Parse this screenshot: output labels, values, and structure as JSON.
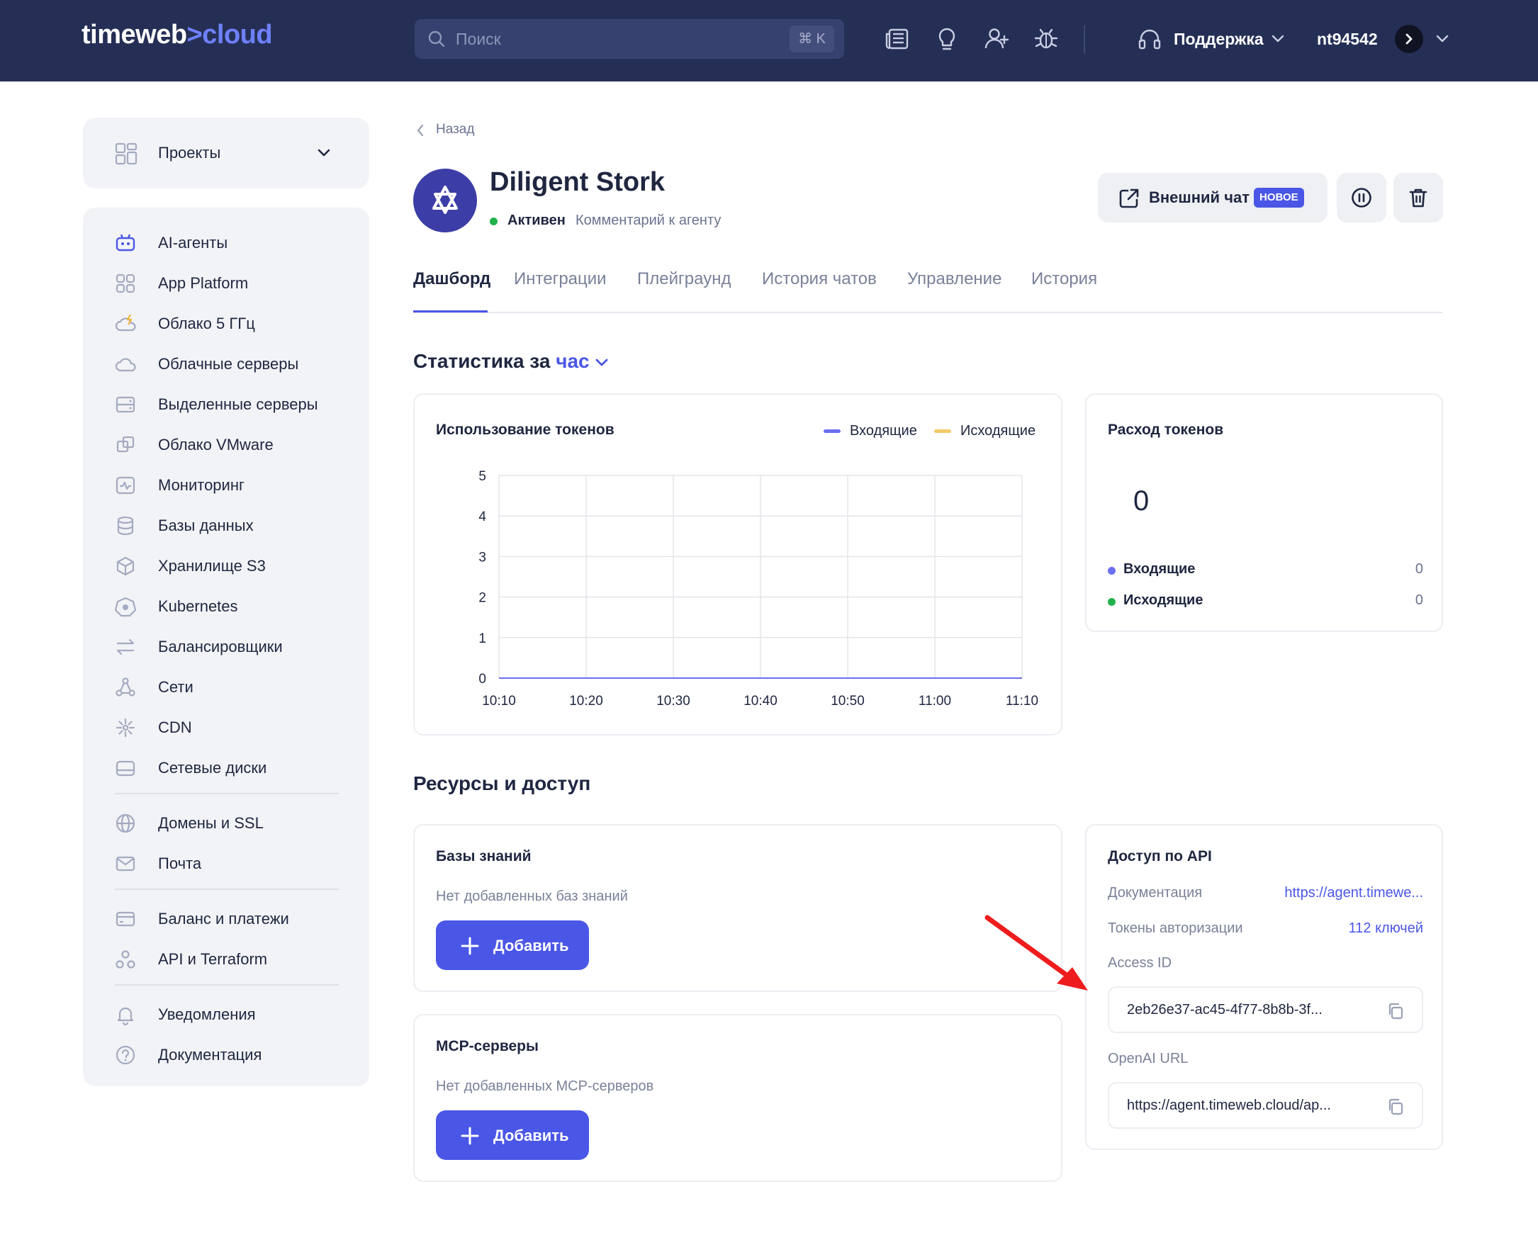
{
  "header": {
    "logo_main": "timeweb",
    "logo_sep": ">",
    "logo_accent": "cloud",
    "search_placeholder": "Поиск",
    "search_shortcut": "⌘ K",
    "icons": [
      "news-icon",
      "lightbulb-icon",
      "add-user-icon",
      "bug-icon"
    ],
    "support_label": "Поддержка",
    "user_name": "nt94542"
  },
  "sidebar": {
    "projects_label": "Проекты",
    "items": [
      {
        "label": "AI-агенты",
        "icon": "ai-agent-icon"
      },
      {
        "label": "App Platform",
        "icon": "app-platform-icon"
      },
      {
        "label": "Облако 5 ГГц",
        "icon": "cloud-lightning-icon"
      },
      {
        "label": "Облачные серверы",
        "icon": "cloud-icon"
      },
      {
        "label": "Выделенные серверы",
        "icon": "server-icon"
      },
      {
        "label": "Облако VMware",
        "icon": "vmware-icon"
      },
      {
        "label": "Мониторинг",
        "icon": "monitoring-icon"
      },
      {
        "label": "Базы данных",
        "icon": "database-icon"
      },
      {
        "label": "Хранилище S3",
        "icon": "storage-cube-icon"
      },
      {
        "label": "Kubernetes",
        "icon": "kubernetes-icon"
      },
      {
        "label": "Балансировщики",
        "icon": "balancer-icon"
      },
      {
        "label": "Сети",
        "icon": "network-icon"
      },
      {
        "label": "CDN",
        "icon": "cdn-icon"
      },
      {
        "label": "Сетевые диски",
        "icon": "network-disk-icon"
      },
      {
        "label": "Домены и SSL",
        "icon": "globe-icon"
      },
      {
        "label": "Почта",
        "icon": "mail-icon"
      },
      {
        "label": "Баланс и платежи",
        "icon": "card-icon"
      },
      {
        "label": "API и Terraform",
        "icon": "api-icon"
      },
      {
        "label": "Уведомления",
        "icon": "bell-icon"
      },
      {
        "label": "Документация",
        "icon": "help-icon"
      }
    ]
  },
  "agent": {
    "back_label": "Назад",
    "name": "Diligent Stork",
    "status": "Активен",
    "comment": "Комментарий к агенту",
    "ext_chat_label": "Внешний чат",
    "ext_chat_badge": "НОВОЕ"
  },
  "tabs": [
    "Дашборд",
    "Интеграции",
    "Плейграунд",
    "История чатов",
    "Управление",
    "История"
  ],
  "stats": {
    "title_prefix": "Статистика за",
    "period": "час"
  },
  "token_usage": {
    "title": "Использование токенов"
  },
  "chart_data": {
    "type": "line",
    "title": "Использование токенов",
    "x": [
      "10:10",
      "10:20",
      "10:30",
      "10:40",
      "10:50",
      "11:00",
      "11:10"
    ],
    "y_ticks": [
      "0",
      "1",
      "2",
      "3",
      "4",
      "5"
    ],
    "ylim": [
      0,
      5
    ],
    "grid": true,
    "legend_position": "top-right",
    "series": [
      {
        "name": "Входящие",
        "color": "#6b6ff0",
        "values": [
          0,
          0,
          0,
          0,
          0,
          0,
          0
        ]
      },
      {
        "name": "Исходящие",
        "color": "#f3c969",
        "values": [
          0,
          0,
          0,
          0,
          0,
          0,
          0
        ]
      }
    ]
  },
  "token_spend": {
    "title": "Расход токенов",
    "total": "0",
    "rows": [
      {
        "label": "Входящие",
        "value": "0",
        "color": "#6b6ff0"
      },
      {
        "label": "Исходящие",
        "value": "0",
        "color": "#22b14c"
      }
    ]
  },
  "resources": {
    "title": "Ресурсы и доступ",
    "knowledge_title": "Базы знаний",
    "knowledge_empty": "Нет добавленных баз знаний",
    "mcp_title": "MCP-серверы",
    "mcp_empty": "Нет добавленных MCP-серверов",
    "add_label": "Добавить"
  },
  "api_access": {
    "title": "Доступ по API",
    "docs_label": "Документация",
    "docs_value": "https://agent.timewe...",
    "tokens_label": "Токены авторизации",
    "tokens_value": "112 ключей",
    "access_id_label": "Access ID",
    "access_id_value": "2eb26e37-ac45-4f77-8b8b-3f...",
    "openai_label": "OpenAI URL",
    "openai_value": "https://agent.timeweb.cloud/ap..."
  },
  "colors": {
    "header_bg": "#252f55",
    "accent": "#4a56e6",
    "annotation_arrow": "#ee1c1c"
  }
}
